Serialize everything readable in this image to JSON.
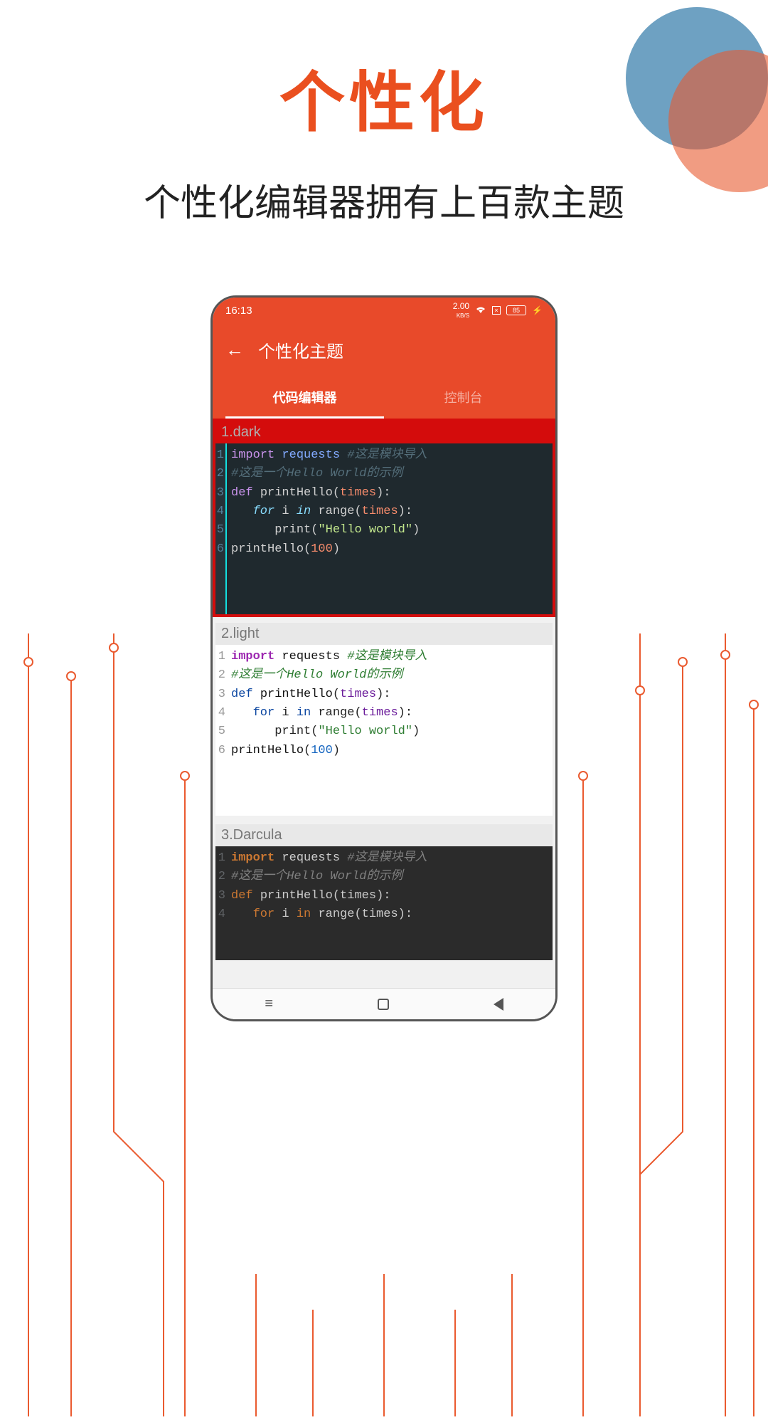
{
  "hero": {
    "title": "个性化",
    "subtitle": "个性化编辑器拥有上百款主题"
  },
  "statusbar": {
    "time": "16:13",
    "netspeed": "2.00",
    "netunit": "KB/S",
    "battery": "85"
  },
  "appbar": {
    "title": "个性化主题",
    "tabs": [
      {
        "label": "代码编辑器",
        "active": true
      },
      {
        "label": "控制台",
        "active": false
      }
    ]
  },
  "code": {
    "lines": [
      "1",
      "2",
      "3",
      "4",
      "5",
      "6"
    ],
    "import_kw": "import",
    "import_mod": "requests",
    "comment1": "#这是模块导入",
    "comment2": "#这是一个Hello World的示例",
    "def_kw": "def",
    "fn_name": "printHello",
    "param": "times",
    "for_kw": "for",
    "var_i": "i",
    "in_kw": "in",
    "range_fn": "range",
    "print_fn": "print",
    "string": "\"Hello world\"",
    "call_num": "100"
  },
  "themes": [
    {
      "label": "1.dark"
    },
    {
      "label": "2.light"
    },
    {
      "label": "3.Darcula"
    }
  ]
}
